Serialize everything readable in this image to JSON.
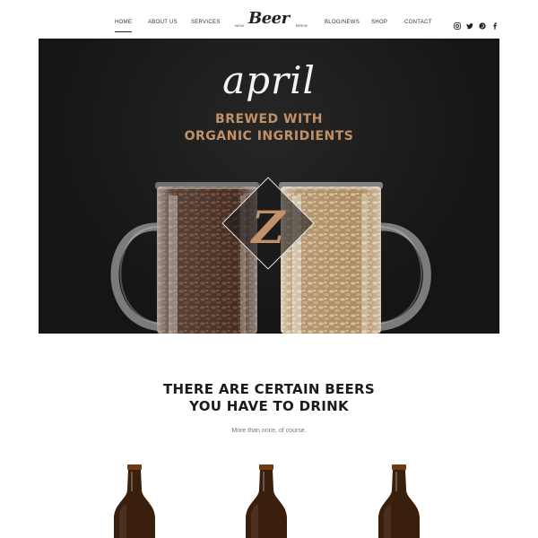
{
  "nav": {
    "items": [
      {
        "label": "HOME",
        "active": true
      },
      {
        "label": "ABOUT US"
      },
      {
        "label": "SERVICES"
      },
      {
        "label": "BLOG/NEWS"
      },
      {
        "label": "SHOP"
      },
      {
        "label": "CONTACT"
      }
    ],
    "logo": {
      "script": "Beer",
      "small_left": "NEW",
      "small_right": "BREW"
    },
    "social_icons": [
      "instagram-icon",
      "twitter-icon",
      "pinterest-icon",
      "facebook-icon"
    ]
  },
  "hero": {
    "script_title": "april",
    "line1": "BREWED WITH",
    "line2": "ORGANIC INGRIDIENTS",
    "badge_letters": "Z",
    "colors": {
      "background": "#1b1b1b",
      "accent": "#c39167",
      "script": "#f2f2f2"
    }
  },
  "section": {
    "title_line1": "THERE ARE CERTAIN BEERS",
    "title_line2": "YOU HAVE TO DRINK",
    "subtitle": "More than once, of course."
  },
  "products": {
    "count_visible": 3,
    "bottle_color": "#3a1f0c"
  }
}
